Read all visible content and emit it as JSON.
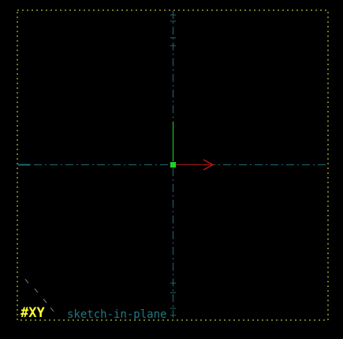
{
  "viewport": {
    "plane_label": "#XY",
    "mode_label": "sketch-in-plane"
  },
  "colors": {
    "background": "#000000",
    "boundary": "#e8e84a",
    "axis_dash": "#1f6a73",
    "origin": "#22d12a",
    "direction_arrow": "#b01818",
    "plane_label": "#ffff33",
    "mode_label": "#1f7a80"
  }
}
